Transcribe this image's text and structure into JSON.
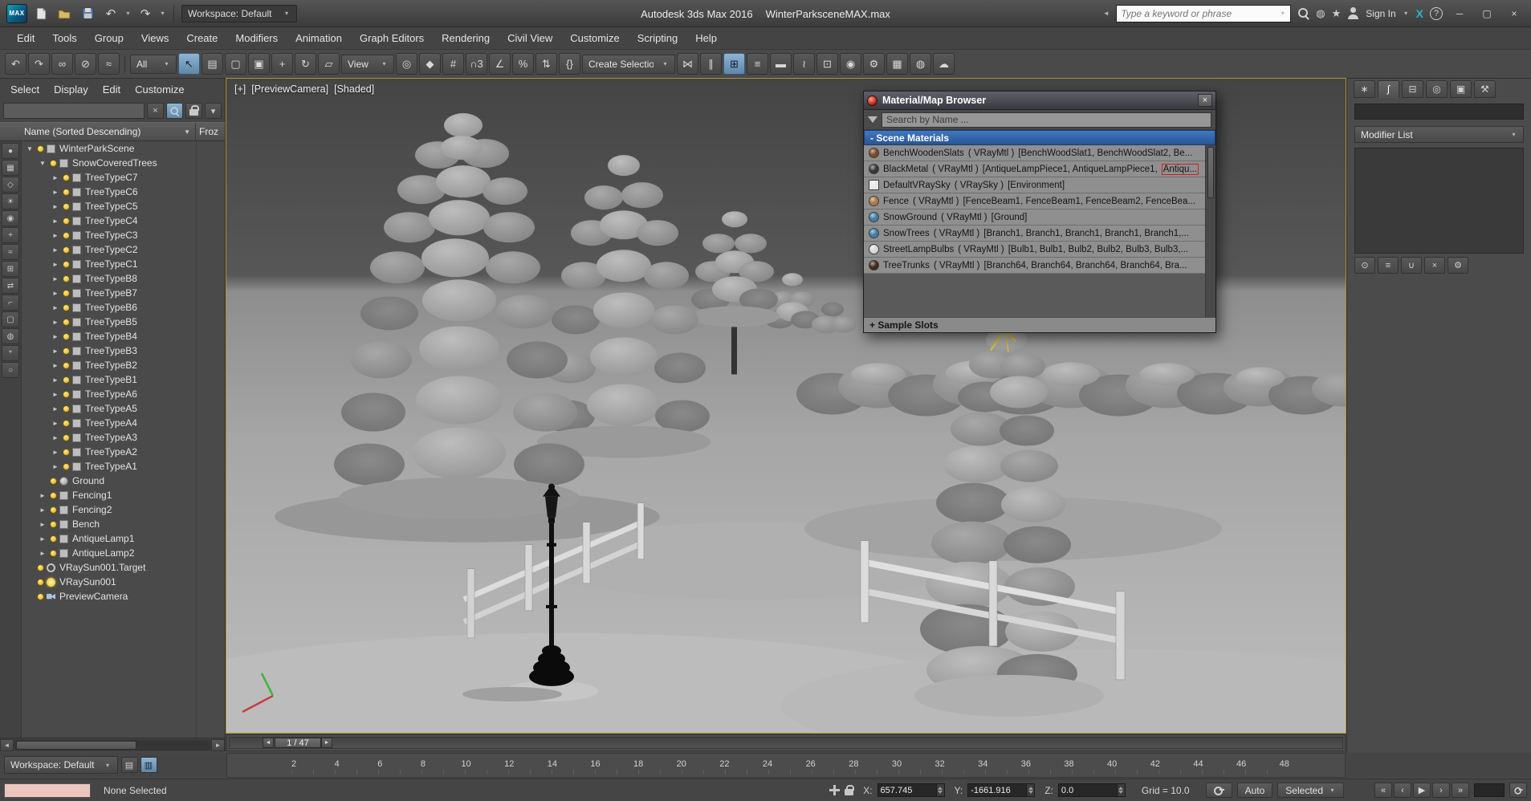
{
  "icons": {
    "dropdown": "▾",
    "minimize": "─",
    "maximize": "▢",
    "close": "×",
    "undo": "↶",
    "redo": "↷",
    "star": "★",
    "exchange": "X",
    "help": "?",
    "comm": "◍",
    "clear": "×",
    "sort_desc": "▼",
    "left": "◄",
    "right": "►",
    "collapse": "◄"
  },
  "titlebar": {
    "logo": "MAX",
    "workspace": "Workspace: Default",
    "app_title": "Autodesk 3ds Max 2016",
    "doc_title": "WinterParksceneMAX.max",
    "search_placeholder": "Type a keyword or phrase",
    "sign_in": "Sign In"
  },
  "menubar": {
    "items": [
      "Edit",
      "Tools",
      "Group",
      "Views",
      "Create",
      "Modifiers",
      "Animation",
      "Graph Editors",
      "Rendering",
      "Civil View",
      "Customize",
      "Scripting",
      "Help"
    ]
  },
  "toolbar": {
    "filter_value": "All",
    "coord_value": "View",
    "selection_set_value": "Create Selection S",
    "group1": [
      {
        "name": "undo-icon",
        "glyph": "↶"
      },
      {
        "name": "redo-icon",
        "glyph": "↷"
      },
      {
        "name": "select-and-link-icon",
        "glyph": "∞"
      },
      {
        "name": "unlink-selection-icon",
        "glyph": "⊘"
      },
      {
        "name": "bind-to-space-warp-icon",
        "glyph": "≈"
      }
    ],
    "group2": [
      {
        "name": "select-object-icon",
        "glyph": "↖",
        "state": "active"
      },
      {
        "name": "select-by-name-icon",
        "glyph": "▤"
      },
      {
        "name": "rectangular-selection-region-icon",
        "glyph": "▢"
      },
      {
        "name": "window-crossing-icon",
        "glyph": "▣"
      },
      {
        "name": "select-and-move-icon",
        "glyph": "+"
      },
      {
        "name": "select-and-rotate-icon",
        "glyph": "↻"
      },
      {
        "name": "select-and-scale-icon",
        "glyph": "▱"
      }
    ],
    "group3": [
      {
        "name": "use-pivot-point-icon",
        "glyph": "◎"
      },
      {
        "name": "select-and-manipulate-icon",
        "glyph": "◆"
      },
      {
        "name": "keyboard-shortcut-override-icon",
        "glyph": "#"
      },
      {
        "name": "snaps-toggle-3d-icon",
        "glyph": "∩3"
      },
      {
        "name": "angle-snap-icon",
        "glyph": "∠"
      },
      {
        "name": "percent-snap-icon",
        "glyph": "%"
      },
      {
        "name": "spinner-snap-icon",
        "glyph": "⇅"
      },
      {
        "name": "named-selection-sets-icon",
        "glyph": "{}"
      }
    ],
    "group4": [
      {
        "name": "mirror-icon",
        "glyph": "⋈"
      },
      {
        "name": "align-icon",
        "glyph": "∥"
      },
      {
        "name": "toggle-scene-explorer-icon",
        "glyph": "⊞",
        "state": "active"
      },
      {
        "name": "toggle-layer-explorer-icon",
        "glyph": "≡"
      },
      {
        "name": "toggle-ribbon-icon",
        "glyph": "▬"
      },
      {
        "name": "curve-editor-icon",
        "glyph": "≀"
      },
      {
        "name": "schematic-view-icon",
        "glyph": "⊡"
      },
      {
        "name": "material-editor-icon",
        "glyph": "◉"
      },
      {
        "name": "render-setup-icon",
        "glyph": "⚙"
      },
      {
        "name": "rendered-frame-window-icon",
        "glyph": "▦"
      },
      {
        "name": "render-production-icon",
        "glyph": "◍"
      },
      {
        "name": "a360-render-icon",
        "glyph": "☁"
      }
    ]
  },
  "explorer": {
    "menu": [
      "Select",
      "Display",
      "Edit",
      "Customize"
    ],
    "name_column": "Name (Sorted Descending)",
    "frozen_column": "Froz",
    "tools": [
      {
        "name": "display-all-icon",
        "glyph": "●"
      },
      {
        "name": "display-geometry-icon",
        "glyph": "▦"
      },
      {
        "name": "display-shapes-icon",
        "glyph": "◇"
      },
      {
        "name": "display-lights-icon",
        "glyph": "☀"
      },
      {
        "name": "display-cameras-icon",
        "glyph": "◉"
      },
      {
        "name": "display-helpers-icon",
        "glyph": "+"
      },
      {
        "name": "display-space-warps-icon",
        "glyph": "≈"
      },
      {
        "name": "display-groups-icon",
        "glyph": "⊞"
      },
      {
        "name": "display-xrefs-icon",
        "glyph": "⇄"
      },
      {
        "name": "display-bones-icon",
        "glyph": "⌐"
      },
      {
        "name": "display-containers-icon",
        "glyph": "▢"
      },
      {
        "name": "display-materials-icon",
        "glyph": "◍"
      },
      {
        "name": "display-frozen-icon",
        "glyph": "*"
      },
      {
        "name": "display-hidden-icon",
        "glyph": "○"
      }
    ],
    "nodes": [
      {
        "label": "WinterParkScene",
        "depth": 0,
        "arrow": "▼",
        "icon": "box"
      },
      {
        "label": "SnowCoveredTrees",
        "depth": 1,
        "arrow": "▼",
        "icon": "box"
      },
      {
        "label": "TreeTypeC7",
        "depth": 2,
        "arrow": "►",
        "icon": "box"
      },
      {
        "label": "TreeTypeC6",
        "depth": 2,
        "arrow": "►",
        "icon": "box"
      },
      {
        "label": "TreeTypeC5",
        "depth": 2,
        "arrow": "►",
        "icon": "box"
      },
      {
        "label": "TreeTypeC4",
        "depth": 2,
        "arrow": "►",
        "icon": "box"
      },
      {
        "label": "TreeTypeC3",
        "depth": 2,
        "arrow": "►",
        "icon": "box"
      },
      {
        "label": "TreeTypeC2",
        "depth": 2,
        "arrow": "►",
        "icon": "box"
      },
      {
        "label": "TreeTypeC1",
        "depth": 2,
        "arrow": "►",
        "icon": "box"
      },
      {
        "label": "TreeTypeB8",
        "depth": 2,
        "arrow": "►",
        "icon": "box"
      },
      {
        "label": "TreeTypeB7",
        "depth": 2,
        "arrow": "►",
        "icon": "box"
      },
      {
        "label": "TreeTypeB6",
        "depth": 2,
        "arrow": "►",
        "icon": "box"
      },
      {
        "label": "TreeTypeB5",
        "depth": 2,
        "arrow": "►",
        "icon": "box"
      },
      {
        "label": "TreeTypeB4",
        "depth": 2,
        "arrow": "►",
        "icon": "box"
      },
      {
        "label": "TreeTypeB3",
        "depth": 2,
        "arrow": "►",
        "icon": "box"
      },
      {
        "label": "TreeTypeB2",
        "depth": 2,
        "arrow": "►",
        "icon": "box"
      },
      {
        "label": "TreeTypeB1",
        "depth": 2,
        "arrow": "►",
        "icon": "box"
      },
      {
        "label": "TreeTypeA6",
        "depth": 2,
        "arrow": "►",
        "icon": "box"
      },
      {
        "label": "TreeTypeA5",
        "depth": 2,
        "arrow": "►",
        "icon": "box"
      },
      {
        "label": "TreeTypeA4",
        "depth": 2,
        "arrow": "►",
        "icon": "box"
      },
      {
        "label": "TreeTypeA3",
        "depth": 2,
        "arrow": "►",
        "icon": "box"
      },
      {
        "label": "TreeTypeA2",
        "depth": 2,
        "arrow": "►",
        "icon": "box"
      },
      {
        "label": "TreeTypeA1",
        "depth": 2,
        "arrow": "►",
        "icon": "box"
      },
      {
        "label": "Ground",
        "depth": 1,
        "arrow": "",
        "icon": "circle"
      },
      {
        "label": "Fencing1",
        "depth": 1,
        "arrow": "►",
        "icon": "box"
      },
      {
        "label": "Fencing2",
        "depth": 1,
        "arrow": "►",
        "icon": "box"
      },
      {
        "label": "Bench",
        "depth": 1,
        "arrow": "►",
        "icon": "box"
      },
      {
        "label": "AntiqueLamp1",
        "depth": 1,
        "arrow": "►",
        "icon": "box"
      },
      {
        "label": "AntiqueLamp2",
        "depth": 1,
        "arrow": "►",
        "icon": "box"
      },
      {
        "label": "VRaySun001.Target",
        "depth": 0,
        "arrow": "",
        "icon": "target"
      },
      {
        "label": "VRaySun001",
        "depth": 0,
        "arrow": "",
        "icon": "sun"
      },
      {
        "label": "PreviewCamera",
        "depth": 0,
        "arrow": "",
        "icon": "camera"
      }
    ]
  },
  "viewport": {
    "label_general": "[+]",
    "label_pov": "[PreviewCamera]",
    "label_shading": "[Shaded]"
  },
  "material_browser": {
    "title": "Material/Map Browser",
    "search_placeholder": "Search by Name ...",
    "scene_materials_header": "- Scene Materials",
    "sample_slots_header": "+ Sample Slots",
    "materials": [
      {
        "name": "BenchWoodenSlats",
        "type": "( VRayMtl )",
        "objects": "[BenchWoodSlat1, BenchWoodSlat2, Be...",
        "color": "#7a4a28",
        "shape": "sphere"
      },
      {
        "name": "BlackMetal",
        "type": "( VRayMtl )",
        "objects": "[AntiqueLampPiece1, AntiqueLampPiece1,",
        "hl": "Antiqu...",
        "color": "#35373c",
        "shape": "sphere"
      },
      {
        "name": "DefaultVRaySky",
        "type": "( VRaySky )",
        "objects": "[Environment]",
        "color": "#e8e8e8",
        "shape": "square"
      },
      {
        "name": "Fence",
        "type": "( VRayMtl )",
        "objects": "[FenceBeam1, FenceBeam1, FenceBeam2, FenceBea...",
        "color": "#a87a45",
        "shape": "sphere"
      },
      {
        "name": "SnowGround",
        "type": "( VRayMtl )",
        "objects": "[Ground]",
        "color": "#3f7fa6",
        "shape": "sphere"
      },
      {
        "name": "SnowTrees",
        "type": "( VRayMtl )",
        "objects": "[Branch1, Branch1, Branch1, Branch1, Branch1,...",
        "color": "#3f7fa6",
        "shape": "sphere"
      },
      {
        "name": "StreetLampBulbs",
        "type": "( VRayMtl )",
        "objects": "[Bulb1, Bulb1, Bulb2, Bulb2, Bulb3, Bulb3,...",
        "color": "#d8d8d8",
        "shape": "sphere"
      },
      {
        "name": "TreeTrunks",
        "type": "( VRayMtl )",
        "objects": "[Branch64, Branch64, Branch64, Branch64, Bra...",
        "color": "#44291a",
        "shape": "sphere"
      }
    ]
  },
  "command_panel": {
    "tabs": [
      {
        "name": "tab-create",
        "glyph": "∗"
      },
      {
        "name": "tab-modify",
        "glyph": "∫",
        "state": "active"
      },
      {
        "name": "tab-hierarchy",
        "glyph": "⊟"
      },
      {
        "name": "tab-motion",
        "glyph": "◎"
      },
      {
        "name": "tab-display",
        "glyph": "▣"
      },
      {
        "name": "tab-utilities",
        "glyph": "⚒"
      }
    ],
    "modifier_list_label": "Modifier List",
    "stack_buttons": [
      {
        "name": "pin-stack-icon",
        "glyph": "⊙"
      },
      {
        "name": "show-end-result-icon",
        "glyph": "≡"
      },
      {
        "name": "make-unique-icon",
        "glyph": "∪"
      },
      {
        "name": "remove-modifier-icon",
        "glyph": "×"
      },
      {
        "name": "configure-modifier-sets-icon",
        "glyph": "⚙"
      }
    ]
  },
  "timeline": {
    "slider_value": "1 / 47",
    "ticks": [
      "2",
      "4",
      "6",
      "8",
      "10",
      "12",
      "14",
      "16",
      "18",
      "20",
      "22",
      "24",
      "26",
      "28",
      "30",
      "32",
      "34",
      "36",
      "38",
      "40",
      "42",
      "44",
      "46",
      "48"
    ]
  },
  "bottombar": {
    "workspace": "Workspace: Default",
    "buttons": [
      {
        "name": "scene-explorer-toggle-icon",
        "glyph": "▤"
      },
      {
        "name": "layer-explorer-toggle-icon",
        "glyph": "▥",
        "state": "active"
      }
    ],
    "status": "None Selected",
    "x_label": "X:",
    "x_value": "657.745",
    "y_label": "Y:",
    "y_value": "-1661.916",
    "z_label": "Z:",
    "z_value": "0.0",
    "grid": "Grid = 10.0",
    "auto_key": "Auto",
    "key_filter": "Selected",
    "transport": [
      {
        "name": "go-to-start-icon",
        "glyph": "«"
      },
      {
        "name": "previous-frame-icon",
        "glyph": "‹"
      },
      {
        "name": "play-animation-icon",
        "glyph": "▶"
      },
      {
        "name": "next-frame-icon",
        "glyph": "›"
      },
      {
        "name": "go-to-end-icon",
        "glyph": "»"
      }
    ]
  }
}
